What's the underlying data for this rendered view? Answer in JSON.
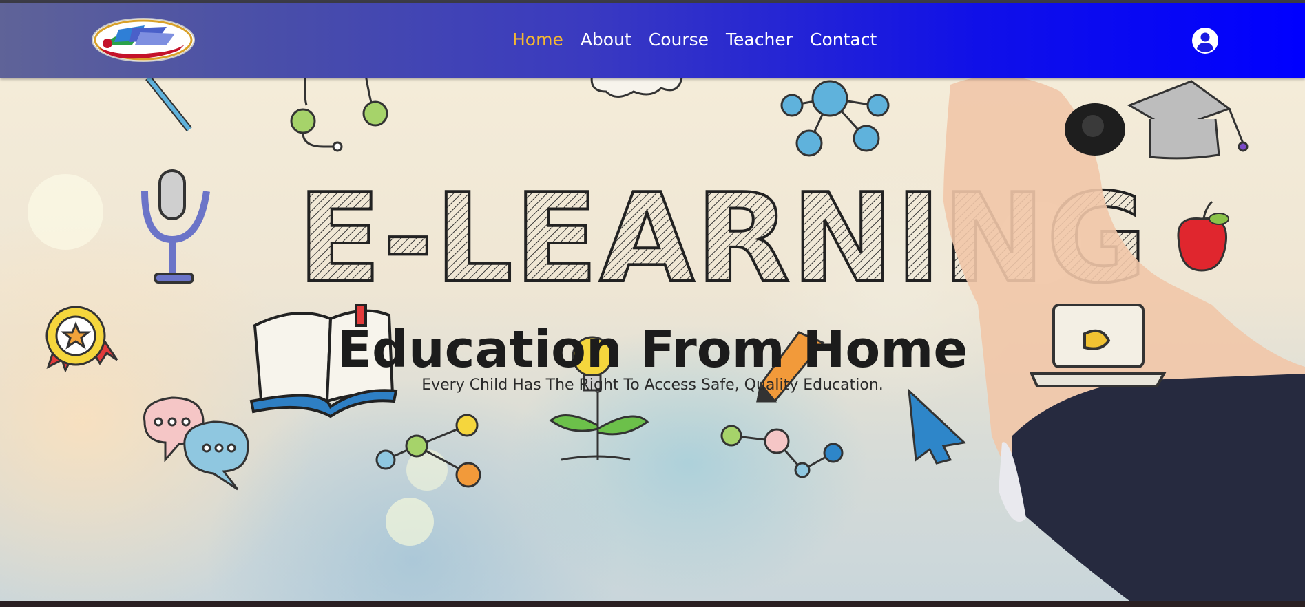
{
  "nav": {
    "items": [
      {
        "label": "Home",
        "active": true
      },
      {
        "label": "About",
        "active": false
      },
      {
        "label": "Course",
        "active": false
      },
      {
        "label": "Teacher",
        "active": false
      },
      {
        "label": "Contact",
        "active": false
      }
    ],
    "user_icon": "user-circle-icon",
    "logo": "school-logo"
  },
  "hero": {
    "banner_word": "E-LEARNING",
    "title": "Education From Home",
    "subtitle": "Every Child Has The Right To Access Safe, Quality Education."
  },
  "colors": {
    "nav_active": "#f5b731",
    "nav_text": "#ffffff",
    "nav_gradient_start": "#5f6398",
    "nav_gradient_end": "#0000ff"
  }
}
